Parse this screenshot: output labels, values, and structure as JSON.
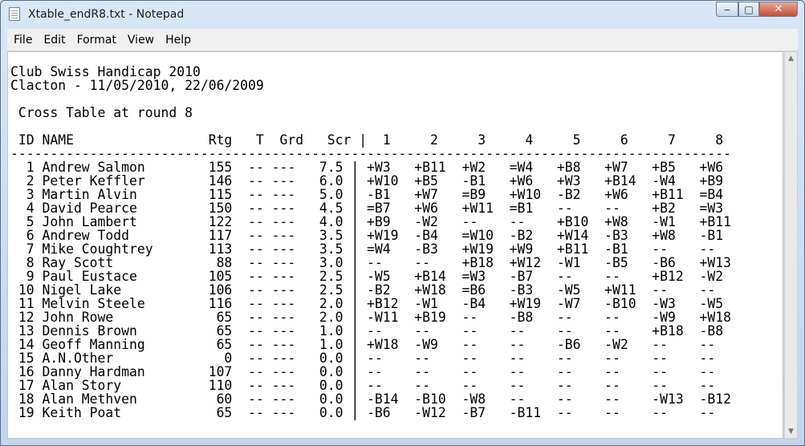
{
  "window": {
    "title": "Xtable_endR8.txt - Notepad",
    "minimize_glyph": "‒",
    "maximize_glyph": "□",
    "close_glyph": "✕"
  },
  "menu": [
    "File",
    "Edit",
    "Format",
    "View",
    "Help"
  ],
  "document": {
    "lines": [
      "Club Swiss Handicap 2010",
      "Clacton - 11/05/2010, 22/06/2009",
      "",
      " Cross Table at round 8",
      "",
      " ID NAME                 Rtg   T  Grd   Scr |  1     2     3     4     5     6     7     8",
      "-------------------------------------------------------------------------------------------",
      "  1 Andrew Salmon        155  -- ---   7.5 | +W3   +B11  +W2   =W4   +B8   +W7   +B5   +W6",
      "  2 Peter Keffler        146  -- ---   6.0 | +W10  +B5   -B1   +W6   +W3   +B14  -W4   +B9",
      "  3 Martin Alvin         115  -- ---   5.0 | -B1   +W7   =B9   +W10  -B2   +W6   +B11  =B4",
      "  4 David Pearce         150  -- ---   4.5 | =B7   +W6   +W11  =B1   --    --    +B2   =W3",
      "  5 John Lambert         122  -- ---   4.0 | +B9   -W2   --    --    +B10  +W8   -W1   +B11",
      "  6 Andrew Todd          117  -- ---   3.5 | +W19  -B4   =W10  -B2   +W14  -B3   +W8   -B1",
      "  7 Mike Coughtrey       113  -- ---   3.5 | =W4   -B3   +W19  +W9   +B11  -B1   --    --",
      "  8 Ray Scott             88  -- ---   3.0 | --    --    +B18  +W12  -W1   -B5   -B6   +W13",
      "  9 Paul Eustace         105  -- ---   2.5 | -W5   +B14  =W3   -B7   --    --    +B12  -W2",
      " 10 Nigel Lake           106  -- ---   2.5 | -B2   +W18  =B6   -B3   -W5   +W11  --    --",
      " 11 Melvin Steele        116  -- ---   2.0 | +B12  -W1   -B4   +W19  -W7   -B10  -W3   -W5",
      " 12 John Rowe             65  -- ---   2.0 | -W11  +B19  --    -B8   --    --    -W9   +W18",
      " 13 Dennis Brown          65  -- ---   1.0 | --    --    --    --    --    --    +B18  -B8",
      " 14 Geoff Manning         65  -- ---   1.0 | +W18  -W9   --    --    -B6   -W2   --    --",
      " 15 A.N.Other              0  -- ---   0.0 | --    --    --    --    --    --    --    --",
      " 16 Danny Hardman        107  -- ---   0.0 | --    --    --    --    --    --    --    --",
      " 17 Alan Story           110  -- ---   0.0 | --    --    --    --    --    --    --    --",
      " 18 Alan Methven          60  -- ---   0.0 | -B14  -B10  -W8   --    --    --    -W13  -B12",
      " 19 Keith Poat            65  -- ---   0.0 | -B6   -W12  -B7   -B11  --    --    --    --"
    ]
  },
  "scrollbar": {
    "up_glyph": "▲",
    "down_glyph": "▼"
  }
}
